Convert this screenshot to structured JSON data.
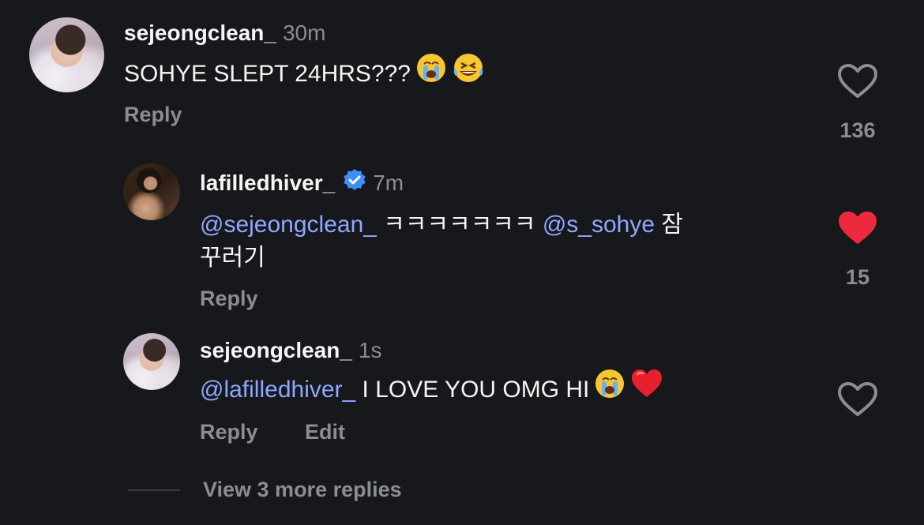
{
  "comments": [
    {
      "username": "sejeongclean_",
      "time": "30m",
      "text": "SOHYE SLEPT 24HRS???",
      "reply_label": "Reply",
      "likes": "136",
      "liked": false
    },
    {
      "username": "lafilledhiver_",
      "verified": true,
      "time": "7m",
      "mention1": "@sejeongclean_",
      "text_mid": " ㅋㅋㅋㅋㅋㅋㅋ ",
      "mention2": "@s_sohye",
      "text_end1": " 잠",
      "text_end2": "꾸러기",
      "reply_label": "Reply",
      "likes": "15",
      "liked": true
    },
    {
      "username": "sejeongclean_",
      "time": "1s",
      "mention": "@lafilledhiver_",
      "text": " I LOVE YOU OMG HI",
      "reply_label": "Reply",
      "edit_label": "Edit",
      "liked": false
    }
  ],
  "view_more": "View 3 more replies",
  "colors": {
    "background": "#16181c",
    "mention": "#8fa8ff",
    "muted": "#8a8d93",
    "liked_heart": "#ed2a3d",
    "verified": "#3f8ef5"
  },
  "icons": [
    "heart-icon",
    "heart-filled-icon",
    "verified-badge-icon",
    "crying-emoji",
    "laughing-emoji",
    "red-heart-emoji"
  ]
}
